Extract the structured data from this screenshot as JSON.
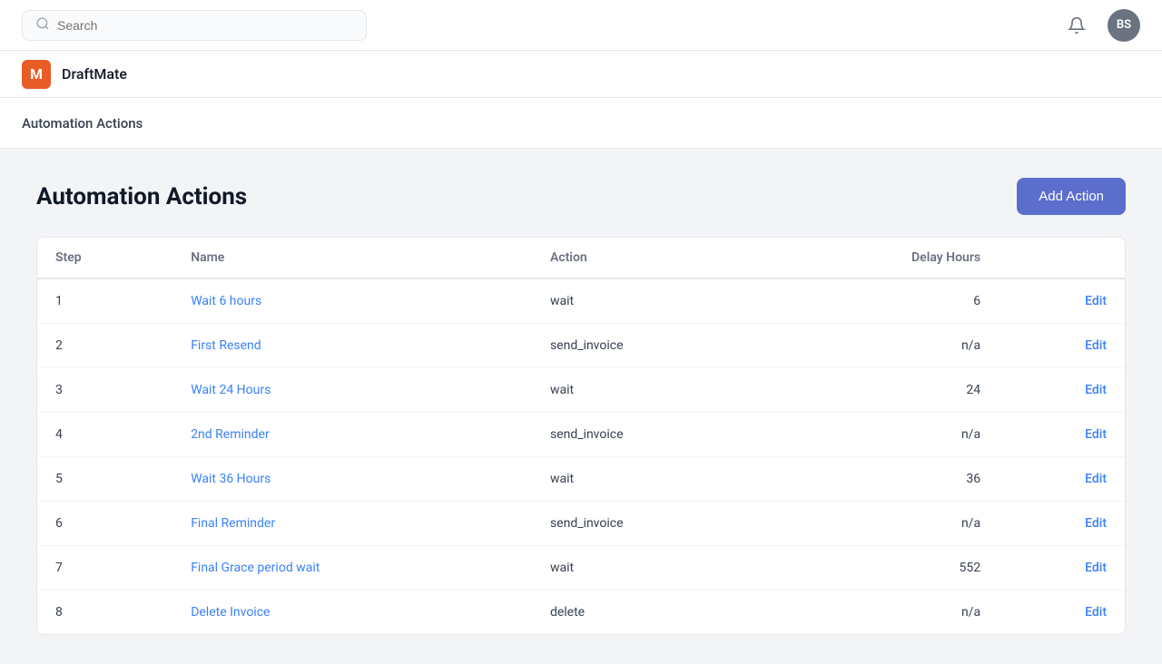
{
  "topbar": {
    "search_placeholder": "Search",
    "avatar_initials": "BS"
  },
  "brand": {
    "logo_letter": "M",
    "name": "DraftMate"
  },
  "breadcrumb": {
    "label": "Automation Actions"
  },
  "main": {
    "title": "Automation Actions",
    "add_button_label": "Add Action",
    "table": {
      "columns": [
        {
          "key": "step",
          "label": "Step"
        },
        {
          "key": "name",
          "label": "Name"
        },
        {
          "key": "action",
          "label": "Action"
        },
        {
          "key": "delay_hours",
          "label": "Delay Hours"
        },
        {
          "key": "edit",
          "label": ""
        }
      ],
      "rows": [
        {
          "step": "1",
          "name": "Wait 6 hours",
          "action": "wait",
          "delay_hours": "6",
          "edit": "Edit"
        },
        {
          "step": "2",
          "name": "First Resend",
          "action": "send_invoice",
          "delay_hours": "n/a",
          "edit": "Edit"
        },
        {
          "step": "3",
          "name": "Wait 24 Hours",
          "action": "wait",
          "delay_hours": "24",
          "edit": "Edit"
        },
        {
          "step": "4",
          "name": "2nd Reminder",
          "action": "send_invoice",
          "delay_hours": "n/a",
          "edit": "Edit"
        },
        {
          "step": "5",
          "name": "Wait 36 Hours",
          "action": "wait",
          "delay_hours": "36",
          "edit": "Edit"
        },
        {
          "step": "6",
          "name": "Final Reminder",
          "action": "send_invoice",
          "delay_hours": "n/a",
          "edit": "Edit"
        },
        {
          "step": "7",
          "name": "Final Grace period wait",
          "action": "wait",
          "delay_hours": "552",
          "edit": "Edit"
        },
        {
          "step": "8",
          "name": "Delete Invoice",
          "action": "delete",
          "delay_hours": "n/a",
          "edit": "Edit"
        }
      ]
    }
  }
}
